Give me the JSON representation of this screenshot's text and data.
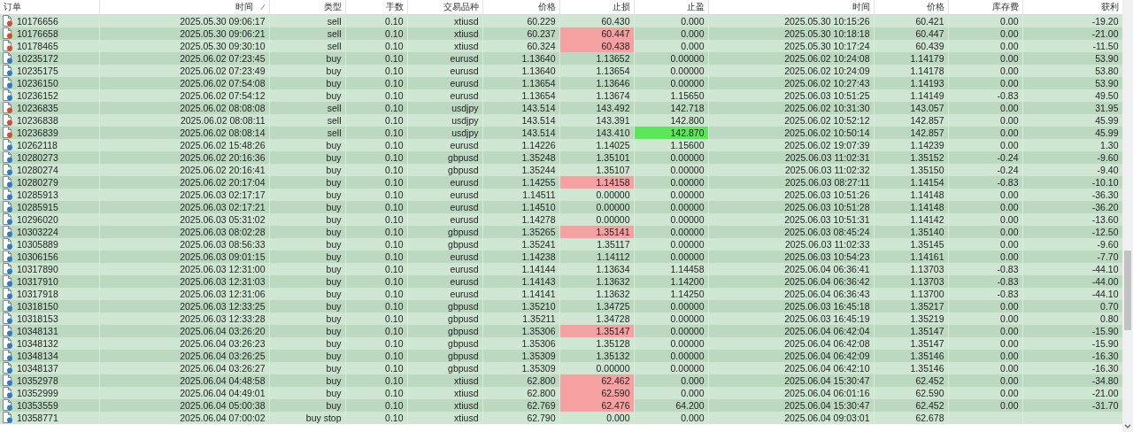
{
  "columns": [
    {
      "label": "订单",
      "sorted": false
    },
    {
      "label": "时间",
      "sorted": true
    },
    {
      "label": "类型",
      "sorted": false
    },
    {
      "label": "手数",
      "sorted": false
    },
    {
      "label": "交易品种",
      "sorted": false
    },
    {
      "label": "价格",
      "sorted": false
    },
    {
      "label": "止损",
      "sorted": false
    },
    {
      "label": "止盈",
      "sorted": false
    },
    {
      "label": "时间",
      "sorted": false
    },
    {
      "label": "价格",
      "sorted": false
    },
    {
      "label": "库存费",
      "sorted": false
    },
    {
      "label": "获利",
      "sorted": false
    }
  ],
  "rows": [
    {
      "kind": "sell",
      "sl_hit": false,
      "tp_hit": false,
      "cells": [
        "10176656",
        "2025.05.30 09:06:17",
        "sell",
        "0.10",
        "xtiusd",
        "60.229",
        "60.430",
        "0.000",
        "2025.05.30 10:15:26",
        "60.421",
        "0.00",
        "-19.20"
      ]
    },
    {
      "kind": "sell",
      "sl_hit": true,
      "tp_hit": false,
      "cells": [
        "10176658",
        "2025.05.30 09:06:21",
        "sell",
        "0.10",
        "xtiusd",
        "60.237",
        "60.447",
        "0.000",
        "2025.05.30 10:18:18",
        "60.447",
        "0.00",
        "-21.00"
      ]
    },
    {
      "kind": "sell",
      "sl_hit": true,
      "tp_hit": false,
      "cells": [
        "10178465",
        "2025.05.30 09:30:10",
        "sell",
        "0.10",
        "xtiusd",
        "60.324",
        "60.438",
        "0.000",
        "2025.05.30 10:17:24",
        "60.439",
        "0.00",
        "-11.50"
      ]
    },
    {
      "kind": "buy",
      "sl_hit": false,
      "tp_hit": false,
      "cells": [
        "10235172",
        "2025.06.02 07:23:45",
        "buy",
        "0.10",
        "eurusd",
        "1.13640",
        "1.13652",
        "0.00000",
        "2025.06.02 10:24:08",
        "1.14179",
        "0.00",
        "53.90"
      ]
    },
    {
      "kind": "buy",
      "sl_hit": false,
      "tp_hit": false,
      "cells": [
        "10235175",
        "2025.06.02 07:23:49",
        "buy",
        "0.10",
        "eurusd",
        "1.13640",
        "1.13654",
        "0.00000",
        "2025.06.02 10:24:09",
        "1.14178",
        "0.00",
        "53.80"
      ]
    },
    {
      "kind": "buy",
      "sl_hit": false,
      "tp_hit": false,
      "cells": [
        "10236150",
        "2025.06.02 07:54:08",
        "buy",
        "0.10",
        "eurusd",
        "1.13654",
        "1.13646",
        "0.00000",
        "2025.06.02 10:27:43",
        "1.14193",
        "0.00",
        "53.90"
      ]
    },
    {
      "kind": "buy",
      "sl_hit": false,
      "tp_hit": false,
      "cells": [
        "10236152",
        "2025.06.02 07:54:12",
        "buy",
        "0.10",
        "eurusd",
        "1.13654",
        "1.13674",
        "1.15650",
        "2025.06.03 10:51:25",
        "1.14149",
        "-0.83",
        "49.50"
      ]
    },
    {
      "kind": "sell",
      "sl_hit": false,
      "tp_hit": false,
      "cells": [
        "10236835",
        "2025.06.02 08:08:08",
        "sell",
        "0.10",
        "usdjpy",
        "143.514",
        "143.492",
        "142.718",
        "2025.06.02 10:31:30",
        "143.057",
        "0.00",
        "31.95"
      ]
    },
    {
      "kind": "sell",
      "sl_hit": false,
      "tp_hit": false,
      "cells": [
        "10236838",
        "2025.06.02 08:08:11",
        "sell",
        "0.10",
        "usdjpy",
        "143.514",
        "143.391",
        "142.800",
        "2025.06.02 10:52:12",
        "142.857",
        "0.00",
        "45.99"
      ]
    },
    {
      "kind": "sell",
      "sl_hit": false,
      "tp_hit": true,
      "cells": [
        "10236839",
        "2025.06.02 08:08:14",
        "sell",
        "0.10",
        "usdjpy",
        "143.514",
        "143.410",
        "142.870",
        "2025.06.02 10:50:14",
        "142.857",
        "0.00",
        "45.99"
      ]
    },
    {
      "kind": "buy",
      "sl_hit": false,
      "tp_hit": false,
      "cells": [
        "10262118",
        "2025.06.02 15:48:26",
        "buy",
        "0.10",
        "eurusd",
        "1.14226",
        "1.14025",
        "1.15600",
        "2025.06.02 19:07:39",
        "1.14239",
        "0.00",
        "1.30"
      ]
    },
    {
      "kind": "buy",
      "sl_hit": false,
      "tp_hit": false,
      "cells": [
        "10280273",
        "2025.06.02 20:16:36",
        "buy",
        "0.10",
        "gbpusd",
        "1.35248",
        "1.35101",
        "0.00000",
        "2025.06.03 11:02:31",
        "1.35152",
        "-0.24",
        "-9.60"
      ]
    },
    {
      "kind": "buy",
      "sl_hit": false,
      "tp_hit": false,
      "cells": [
        "10280274",
        "2025.06.02 20:16:41",
        "buy",
        "0.10",
        "gbpusd",
        "1.35244",
        "1.35107",
        "0.00000",
        "2025.06.03 11:02:32",
        "1.35150",
        "-0.24",
        "-9.40"
      ]
    },
    {
      "kind": "buy",
      "sl_hit": true,
      "tp_hit": false,
      "cells": [
        "10280279",
        "2025.06.02 20:17:04",
        "buy",
        "0.10",
        "eurusd",
        "1.14255",
        "1.14158",
        "0.00000",
        "2025.06.03 08:27:11",
        "1.14154",
        "-0.83",
        "-10.10"
      ]
    },
    {
      "kind": "buy",
      "sl_hit": false,
      "tp_hit": false,
      "cells": [
        "10285913",
        "2025.06.03 02:17:17",
        "buy",
        "0.10",
        "eurusd",
        "1.14511",
        "0.00000",
        "0.00000",
        "2025.06.03 10:51:26",
        "1.14148",
        "0.00",
        "-36.30"
      ]
    },
    {
      "kind": "buy",
      "sl_hit": false,
      "tp_hit": false,
      "cells": [
        "10285915",
        "2025.06.03 02:17:21",
        "buy",
        "0.10",
        "eurusd",
        "1.14510",
        "0.00000",
        "0.00000",
        "2025.06.03 10:51:28",
        "1.14148",
        "0.00",
        "-36.20"
      ]
    },
    {
      "kind": "buy",
      "sl_hit": false,
      "tp_hit": false,
      "cells": [
        "10296020",
        "2025.06.03 05:31:02",
        "buy",
        "0.10",
        "eurusd",
        "1.14278",
        "0.00000",
        "0.00000",
        "2025.06.03 10:51:31",
        "1.14142",
        "0.00",
        "-13.60"
      ]
    },
    {
      "kind": "buy",
      "sl_hit": true,
      "tp_hit": false,
      "cells": [
        "10303224",
        "2025.06.03 08:02:28",
        "buy",
        "0.10",
        "gbpusd",
        "1.35265",
        "1.35141",
        "0.00000",
        "2025.06.03 08:45:24",
        "1.35140",
        "0.00",
        "-12.50"
      ]
    },
    {
      "kind": "buy",
      "sl_hit": false,
      "tp_hit": false,
      "cells": [
        "10305889",
        "2025.06.03 08:56:33",
        "buy",
        "0.10",
        "gbpusd",
        "1.35241",
        "1.35117",
        "0.00000",
        "2025.06.03 11:02:33",
        "1.35145",
        "0.00",
        "-9.60"
      ]
    },
    {
      "kind": "buy",
      "sl_hit": false,
      "tp_hit": false,
      "cells": [
        "10306156",
        "2025.06.03 09:01:15",
        "buy",
        "0.10",
        "eurusd",
        "1.14238",
        "1.14112",
        "0.00000",
        "2025.06.03 10:54:23",
        "1.14161",
        "0.00",
        "-7.70"
      ]
    },
    {
      "kind": "buy",
      "sl_hit": false,
      "tp_hit": false,
      "cells": [
        "10317890",
        "2025.06.03 12:31:00",
        "buy",
        "0.10",
        "eurusd",
        "1.14144",
        "1.13634",
        "1.14458",
        "2025.06.04 06:36:41",
        "1.13703",
        "-0.83",
        "-44.10"
      ]
    },
    {
      "kind": "buy",
      "sl_hit": false,
      "tp_hit": false,
      "cells": [
        "10317910",
        "2025.06.03 12:31:03",
        "buy",
        "0.10",
        "eurusd",
        "1.14143",
        "1.13632",
        "1.14200",
        "2025.06.04 06:36:42",
        "1.13703",
        "-0.83",
        "-44.00"
      ]
    },
    {
      "kind": "buy",
      "sl_hit": false,
      "tp_hit": false,
      "cells": [
        "10317918",
        "2025.06.03 12:31:06",
        "buy",
        "0.10",
        "eurusd",
        "1.14141",
        "1.13632",
        "1.14250",
        "2025.06.04 06:36:43",
        "1.13700",
        "-0.83",
        "-44.10"
      ]
    },
    {
      "kind": "buy",
      "sl_hit": false,
      "tp_hit": false,
      "cells": [
        "10318150",
        "2025.06.03 12:33:25",
        "buy",
        "0.10",
        "gbpusd",
        "1.35210",
        "1.34725",
        "0.00000",
        "2025.06.03 16:45:18",
        "1.35217",
        "0.00",
        "0.70"
      ]
    },
    {
      "kind": "buy",
      "sl_hit": false,
      "tp_hit": false,
      "cells": [
        "10318153",
        "2025.06.03 12:33:28",
        "buy",
        "0.10",
        "gbpusd",
        "1.35211",
        "1.34728",
        "0.00000",
        "2025.06.03 16:45:19",
        "1.35219",
        "0.00",
        "0.80"
      ]
    },
    {
      "kind": "buy",
      "sl_hit": true,
      "tp_hit": false,
      "cells": [
        "10348131",
        "2025.06.04 03:26:20",
        "buy",
        "0.10",
        "gbpusd",
        "1.35306",
        "1.35147",
        "0.00000",
        "2025.06.04 06:42:04",
        "1.35147",
        "0.00",
        "-15.90"
      ]
    },
    {
      "kind": "buy",
      "sl_hit": false,
      "tp_hit": false,
      "cells": [
        "10348132",
        "2025.06.04 03:26:23",
        "buy",
        "0.10",
        "gbpusd",
        "1.35306",
        "1.35128",
        "0.00000",
        "2025.06.04 06:42:08",
        "1.35147",
        "0.00",
        "-15.90"
      ]
    },
    {
      "kind": "buy",
      "sl_hit": false,
      "tp_hit": false,
      "cells": [
        "10348134",
        "2025.06.04 03:26:25",
        "buy",
        "0.10",
        "gbpusd",
        "1.35309",
        "1.35132",
        "0.00000",
        "2025.06.04 06:42:09",
        "1.35146",
        "0.00",
        "-16.30"
      ]
    },
    {
      "kind": "buy",
      "sl_hit": false,
      "tp_hit": false,
      "cells": [
        "10348137",
        "2025.06.04 03:26:27",
        "buy",
        "0.10",
        "gbpusd",
        "1.35309",
        "0.00000",
        "0.00000",
        "2025.06.04 06:42:10",
        "1.35146",
        "0.00",
        "-16.30"
      ]
    },
    {
      "kind": "buy",
      "sl_hit": true,
      "tp_hit": false,
      "cells": [
        "10352978",
        "2025.06.04 04:48:58",
        "buy",
        "0.10",
        "xtiusd",
        "62.800",
        "62.462",
        "0.000",
        "2025.06.04 15:30:47",
        "62.452",
        "0.00",
        "-34.80"
      ]
    },
    {
      "kind": "buy",
      "sl_hit": true,
      "tp_hit": false,
      "cells": [
        "10352999",
        "2025.06.04 04:49:01",
        "buy",
        "0.10",
        "xtiusd",
        "62.800",
        "62.590",
        "0.000",
        "2025.06.04 06:01:16",
        "62.590",
        "0.00",
        "-21.00"
      ]
    },
    {
      "kind": "buy",
      "sl_hit": true,
      "tp_hit": false,
      "cells": [
        "10353559",
        "2025.06.04 05:00:38",
        "buy",
        "0.10",
        "xtiusd",
        "62.769",
        "62.476",
        "64.200",
        "2025.06.04 15:30:47",
        "62.452",
        "0.00",
        "-31.70"
      ]
    },
    {
      "kind": "buy",
      "sl_hit": false,
      "tp_hit": false,
      "cells": [
        "10358771",
        "2025.06.04 07:00:02",
        "buy stop",
        "0.10",
        "xtiusd",
        "62.790",
        "0.000",
        "0.000",
        "2025.06.04 09:03:01",
        "62.678"
      ]
    }
  ]
}
